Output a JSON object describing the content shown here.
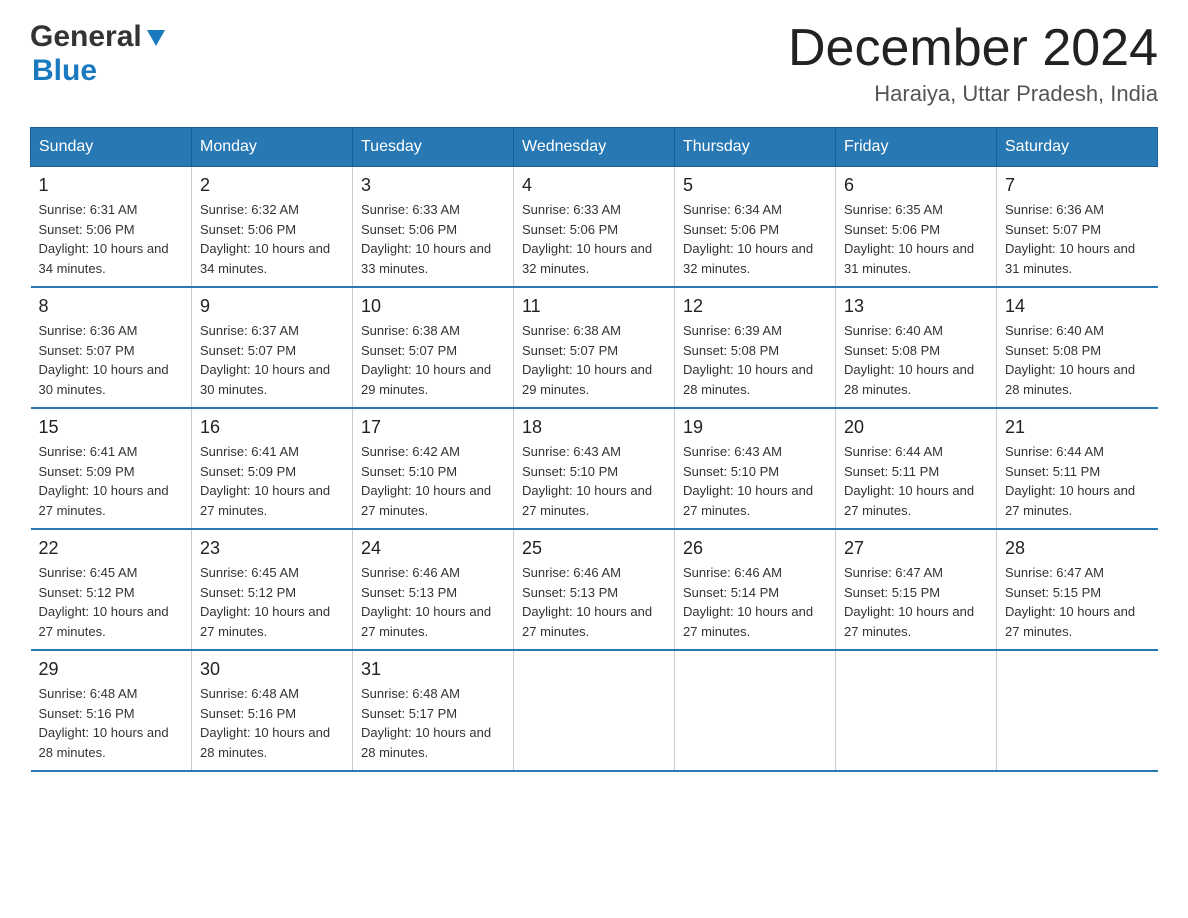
{
  "logo": {
    "general": "General",
    "blue": "Blue"
  },
  "header": {
    "title": "December 2024",
    "subtitle": "Haraiya, Uttar Pradesh, India"
  },
  "columns": [
    "Sunday",
    "Monday",
    "Tuesday",
    "Wednesday",
    "Thursday",
    "Friday",
    "Saturday"
  ],
  "weeks": [
    [
      {
        "day": "1",
        "sunrise": "Sunrise: 6:31 AM",
        "sunset": "Sunset: 5:06 PM",
        "daylight": "Daylight: 10 hours and 34 minutes."
      },
      {
        "day": "2",
        "sunrise": "Sunrise: 6:32 AM",
        "sunset": "Sunset: 5:06 PM",
        "daylight": "Daylight: 10 hours and 34 minutes."
      },
      {
        "day": "3",
        "sunrise": "Sunrise: 6:33 AM",
        "sunset": "Sunset: 5:06 PM",
        "daylight": "Daylight: 10 hours and 33 minutes."
      },
      {
        "day": "4",
        "sunrise": "Sunrise: 6:33 AM",
        "sunset": "Sunset: 5:06 PM",
        "daylight": "Daylight: 10 hours and 32 minutes."
      },
      {
        "day": "5",
        "sunrise": "Sunrise: 6:34 AM",
        "sunset": "Sunset: 5:06 PM",
        "daylight": "Daylight: 10 hours and 32 minutes."
      },
      {
        "day": "6",
        "sunrise": "Sunrise: 6:35 AM",
        "sunset": "Sunset: 5:06 PM",
        "daylight": "Daylight: 10 hours and 31 minutes."
      },
      {
        "day": "7",
        "sunrise": "Sunrise: 6:36 AM",
        "sunset": "Sunset: 5:07 PM",
        "daylight": "Daylight: 10 hours and 31 minutes."
      }
    ],
    [
      {
        "day": "8",
        "sunrise": "Sunrise: 6:36 AM",
        "sunset": "Sunset: 5:07 PM",
        "daylight": "Daylight: 10 hours and 30 minutes."
      },
      {
        "day": "9",
        "sunrise": "Sunrise: 6:37 AM",
        "sunset": "Sunset: 5:07 PM",
        "daylight": "Daylight: 10 hours and 30 minutes."
      },
      {
        "day": "10",
        "sunrise": "Sunrise: 6:38 AM",
        "sunset": "Sunset: 5:07 PM",
        "daylight": "Daylight: 10 hours and 29 minutes."
      },
      {
        "day": "11",
        "sunrise": "Sunrise: 6:38 AM",
        "sunset": "Sunset: 5:07 PM",
        "daylight": "Daylight: 10 hours and 29 minutes."
      },
      {
        "day": "12",
        "sunrise": "Sunrise: 6:39 AM",
        "sunset": "Sunset: 5:08 PM",
        "daylight": "Daylight: 10 hours and 28 minutes."
      },
      {
        "day": "13",
        "sunrise": "Sunrise: 6:40 AM",
        "sunset": "Sunset: 5:08 PM",
        "daylight": "Daylight: 10 hours and 28 minutes."
      },
      {
        "day": "14",
        "sunrise": "Sunrise: 6:40 AM",
        "sunset": "Sunset: 5:08 PM",
        "daylight": "Daylight: 10 hours and 28 minutes."
      }
    ],
    [
      {
        "day": "15",
        "sunrise": "Sunrise: 6:41 AM",
        "sunset": "Sunset: 5:09 PM",
        "daylight": "Daylight: 10 hours and 27 minutes."
      },
      {
        "day": "16",
        "sunrise": "Sunrise: 6:41 AM",
        "sunset": "Sunset: 5:09 PM",
        "daylight": "Daylight: 10 hours and 27 minutes."
      },
      {
        "day": "17",
        "sunrise": "Sunrise: 6:42 AM",
        "sunset": "Sunset: 5:10 PM",
        "daylight": "Daylight: 10 hours and 27 minutes."
      },
      {
        "day": "18",
        "sunrise": "Sunrise: 6:43 AM",
        "sunset": "Sunset: 5:10 PM",
        "daylight": "Daylight: 10 hours and 27 minutes."
      },
      {
        "day": "19",
        "sunrise": "Sunrise: 6:43 AM",
        "sunset": "Sunset: 5:10 PM",
        "daylight": "Daylight: 10 hours and 27 minutes."
      },
      {
        "day": "20",
        "sunrise": "Sunrise: 6:44 AM",
        "sunset": "Sunset: 5:11 PM",
        "daylight": "Daylight: 10 hours and 27 minutes."
      },
      {
        "day": "21",
        "sunrise": "Sunrise: 6:44 AM",
        "sunset": "Sunset: 5:11 PM",
        "daylight": "Daylight: 10 hours and 27 minutes."
      }
    ],
    [
      {
        "day": "22",
        "sunrise": "Sunrise: 6:45 AM",
        "sunset": "Sunset: 5:12 PM",
        "daylight": "Daylight: 10 hours and 27 minutes."
      },
      {
        "day": "23",
        "sunrise": "Sunrise: 6:45 AM",
        "sunset": "Sunset: 5:12 PM",
        "daylight": "Daylight: 10 hours and 27 minutes."
      },
      {
        "day": "24",
        "sunrise": "Sunrise: 6:46 AM",
        "sunset": "Sunset: 5:13 PM",
        "daylight": "Daylight: 10 hours and 27 minutes."
      },
      {
        "day": "25",
        "sunrise": "Sunrise: 6:46 AM",
        "sunset": "Sunset: 5:13 PM",
        "daylight": "Daylight: 10 hours and 27 minutes."
      },
      {
        "day": "26",
        "sunrise": "Sunrise: 6:46 AM",
        "sunset": "Sunset: 5:14 PM",
        "daylight": "Daylight: 10 hours and 27 minutes."
      },
      {
        "day": "27",
        "sunrise": "Sunrise: 6:47 AM",
        "sunset": "Sunset: 5:15 PM",
        "daylight": "Daylight: 10 hours and 27 minutes."
      },
      {
        "day": "28",
        "sunrise": "Sunrise: 6:47 AM",
        "sunset": "Sunset: 5:15 PM",
        "daylight": "Daylight: 10 hours and 27 minutes."
      }
    ],
    [
      {
        "day": "29",
        "sunrise": "Sunrise: 6:48 AM",
        "sunset": "Sunset: 5:16 PM",
        "daylight": "Daylight: 10 hours and 28 minutes."
      },
      {
        "day": "30",
        "sunrise": "Sunrise: 6:48 AM",
        "sunset": "Sunset: 5:16 PM",
        "daylight": "Daylight: 10 hours and 28 minutes."
      },
      {
        "day": "31",
        "sunrise": "Sunrise: 6:48 AM",
        "sunset": "Sunset: 5:17 PM",
        "daylight": "Daylight: 10 hours and 28 minutes."
      },
      null,
      null,
      null,
      null
    ]
  ]
}
